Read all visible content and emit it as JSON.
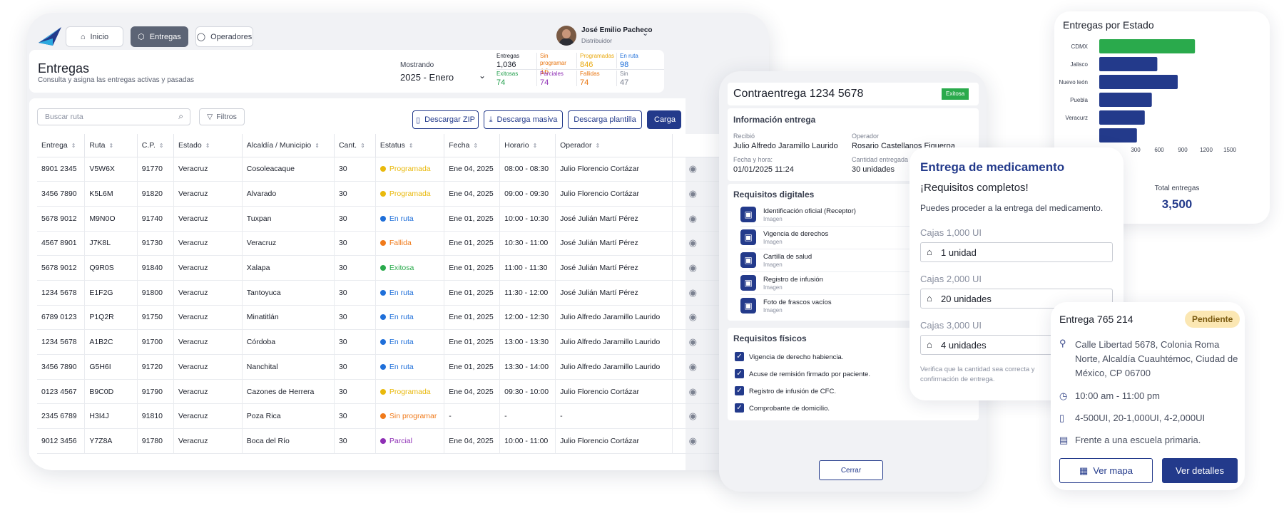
{
  "nav": {
    "home": "Inicio",
    "deliveries": "Entregas",
    "operators": "Operadores"
  },
  "user": {
    "name": "José Emilio Pacheco",
    "role": "Distribuidor"
  },
  "page": {
    "title": "Entregas",
    "subtitle": "Consulta y asigna las entregas activas y pasadas",
    "showing_label": "Mostrando",
    "period": "2025 - Enero"
  },
  "stats": [
    {
      "label": "Entregas",
      "value": "1,036",
      "color": "#1b1f2a"
    },
    {
      "label": "Sin programar",
      "value": "16",
      "color": "#e8730c"
    },
    {
      "label": "Programadas",
      "value": "846",
      "color": "#e9a80c"
    },
    {
      "label": "En ruta",
      "value": "98",
      "color": "#1f6fd9"
    },
    {
      "label": "Exitosas",
      "value": "74",
      "color": "#1f9e4a"
    },
    {
      "label": "Parciales",
      "value": "74",
      "color": "#8e2fb5"
    },
    {
      "label": "Fallidas",
      "value": "74",
      "color": "#e8730c"
    },
    {
      "label": "Sin",
      "value": "47",
      "color": "#7b8190"
    }
  ],
  "toolbar": {
    "search_placeholder": "Buscar ruta",
    "filters": "Filtros",
    "zip": "Descargar ZIP",
    "bulk": "Descarga masiva",
    "template": "Descarga plantilla",
    "upload": "Carga"
  },
  "columns": [
    "Entrega",
    "Ruta",
    "C.P.",
    "Estado",
    "Alcaldía / Municipio",
    "Cant.",
    "Estatus",
    "Fecha",
    "Horario",
    "Operador"
  ],
  "rows": [
    [
      "8901 2345",
      "V5W6X",
      "91770",
      "Veracruz",
      "Cosoleacaque",
      "30",
      "Programada",
      "Ene 04, 2025",
      "08:00 - 08:30",
      "Julio Florencio Cortázar"
    ],
    [
      "3456 7890",
      "K5L6M",
      "91820",
      "Veracruz",
      "Alvarado",
      "30",
      "Programada",
      "Ene 04, 2025",
      "09:00 - 09:30",
      "Julio Florencio Cortázar"
    ],
    [
      "5678 9012",
      "M9N0O",
      "91740",
      "Veracruz",
      "Tuxpan",
      "30",
      "En ruta",
      "Ene 01, 2025",
      "10:00 - 10:30",
      "José Julián Martí Pérez"
    ],
    [
      "4567 8901",
      "J7K8L",
      "91730",
      "Veracruz",
      "Veracruz",
      "30",
      "Fallida",
      "Ene 01, 2025",
      "10:30 - 11:00",
      "José Julián Martí Pérez"
    ],
    [
      "5678 9012",
      "Q9R0S",
      "91840",
      "Veracruz",
      "Xalapa",
      "30",
      "Exitosa",
      "Ene 01, 2025",
      "11:00 - 11:30",
      "José Julián Martí Pérez"
    ],
    [
      "1234 5678",
      "E1F2G",
      "91800",
      "Veracruz",
      "Tantoyuca",
      "30",
      "En ruta",
      "Ene 01, 2025",
      "11:30 - 12:00",
      "José Julián Martí Pérez"
    ],
    [
      "6789 0123",
      "P1Q2R",
      "91750",
      "Veracruz",
      "Minatitlán",
      "30",
      "En ruta",
      "Ene 01, 2025",
      "12:00 - 12:30",
      "Julio Alfredo Jaramillo Laurido"
    ],
    [
      "1234 5678",
      "A1B2C",
      "91700",
      "Veracruz",
      "Córdoba",
      "30",
      "En ruta",
      "Ene 01, 2025",
      "13:00 - 13:30",
      "Julio Alfredo Jaramillo Laurido"
    ],
    [
      "3456 7890",
      "G5H6I",
      "91720",
      "Veracruz",
      "Nanchital",
      "30",
      "En ruta",
      "Ene 01, 2025",
      "13:30 - 14:00",
      "Julio Alfredo Jaramillo Laurido"
    ],
    [
      "0123 4567",
      "B9C0D",
      "91790",
      "Veracruz",
      "Cazones de Herrera",
      "30",
      "Programada",
      "Ene 04, 2025",
      "09:30 - 10:00",
      "Julio Florencio Cortázar"
    ],
    [
      "2345 6789",
      "H3I4J",
      "91810",
      "Veracruz",
      "Poza Rica",
      "30",
      "Sin programar",
      "-",
      "-",
      "-"
    ],
    [
      "9012 3456",
      "Y7Z8A",
      "91780",
      "Veracruz",
      "Boca del Río",
      "30",
      "Parcial",
      "Ene 04, 2025",
      "10:00 - 11:00",
      "Julio Florencio Cortázar"
    ]
  ],
  "status_colors": {
    "Programada": "#e9b90c",
    "En ruta": "#1f6fd9",
    "Fallida": "#f07a1a",
    "Exitosa": "#2aaa4c",
    "Sin programar": "#f07a1a",
    "Parcial": "#8e2fb5"
  },
  "detail": {
    "title": "Contraentrega 1234 5678",
    "badge": "Exitosa",
    "info_title": "Información entrega",
    "received_label": "Recibió",
    "received": "Julio Alfredo Jaramillo Laurido",
    "operator_label": "Operador",
    "operator": "Rosario Castellanos Figueroa",
    "datetime_label": "Fecha y hora:",
    "datetime": "01/01/2025  11:24",
    "qty_label": "Cantidad entregada",
    "qty": "30 unidades",
    "digital_title": "Requisitos digitales",
    "digital": [
      {
        "name": "Identificación oficial (Receptor)",
        "type": "Imagen"
      },
      {
        "name": "Vigencia de derechos",
        "type": "Imagen"
      },
      {
        "name": "Cartilla de salud",
        "type": "Imagen"
      },
      {
        "name": "Registro de infusión",
        "type": "Imagen"
      },
      {
        "name": "Foto de frascos vacíos",
        "type": "Imagen"
      }
    ],
    "physical_title": "Requisitos físicos",
    "physical": [
      "Vigencia de derecho habiencia.",
      "Acuse de remisión firmado por paciente.",
      "Registro de infusión de CFC.",
      "Comprobante de domicilio."
    ],
    "close": "Cerrar"
  },
  "med": {
    "title": "Entrega de medicamento",
    "complete": "¡Requisitos completos!",
    "text": "Puedes proceder a la entrega del medicamento.",
    "boxes": [
      {
        "label": "Cajas 1,000 UI",
        "value": "1 unidad"
      },
      {
        "label": "Cajas 2,000 UI",
        "value": "20 unidades"
      },
      {
        "label": "Cajas 3,000 UI",
        "value": "4 unidades"
      }
    ],
    "note": "Verifica que la cantidad sea correcta y confirmación de entrega."
  },
  "chart_data": {
    "type": "bar",
    "orientation": "horizontal",
    "title": "Entregas por Estado",
    "categories": [
      "CDMX",
      "Jalisco",
      "Nuevo león",
      "Puebla",
      "Veracurz",
      ""
    ],
    "values": [
      1220,
      740,
      1000,
      670,
      580,
      480
    ],
    "colors": [
      "#2aaa4c",
      "#233a8b",
      "#233a8b",
      "#233a8b",
      "#233a8b",
      "#233a8b"
    ],
    "xticks": [
      "300",
      "600",
      "900",
      "1200",
      "1500"
    ],
    "xlim": [
      0,
      1500
    ],
    "total_label": "Total entregas",
    "total": "3,500"
  },
  "card": {
    "title": "Entrega 765 214",
    "badge": "Pendiente",
    "address": "Calle Libertad 5678, Colonia Roma Norte, Alcaldía Cuauhtémoc, Ciudad de México, CP 06700",
    "time": "10:00 am - 11:00 pm",
    "qty": "4-500UI, 20-1,000UI, 4-2,000UI",
    "note": "Frente a una escuela primaria.",
    "map": "Ver mapa",
    "details": "Ver detalles"
  }
}
